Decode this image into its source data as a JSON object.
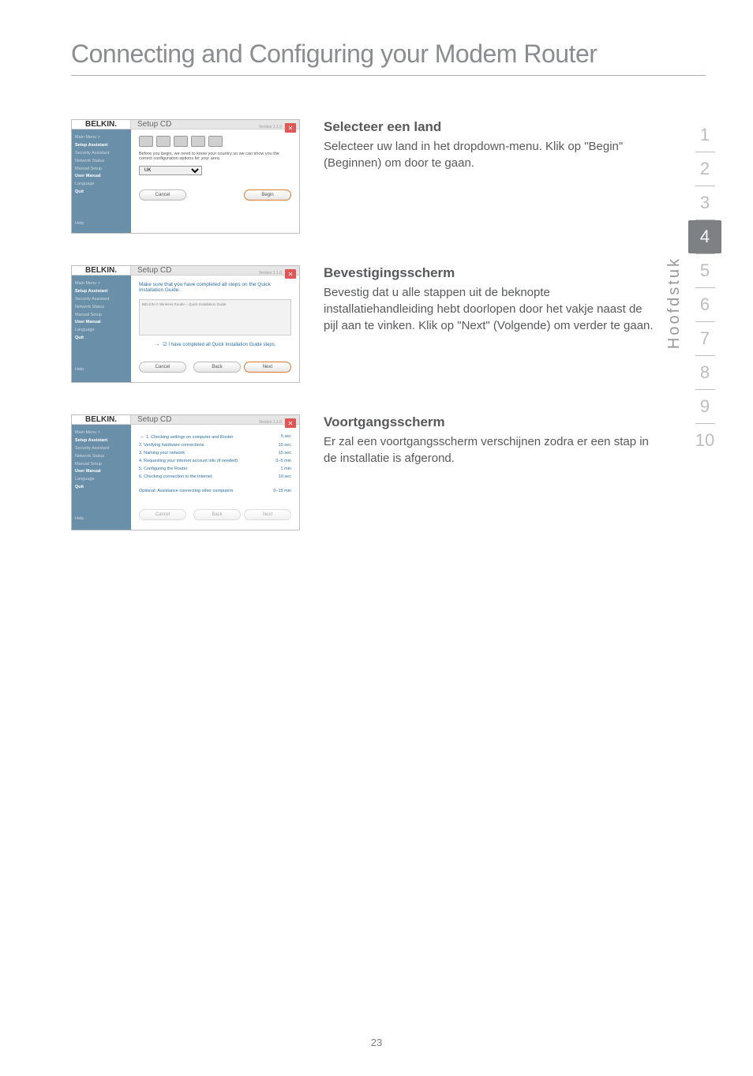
{
  "page_title": "Connecting and Configuring your Modem Router",
  "page_number": "23",
  "chapter_label": "Hoofdstuk",
  "nav": [
    "1",
    "2",
    "3",
    "4",
    "5",
    "6",
    "7",
    "8",
    "9",
    "10"
  ],
  "active_chapter": "4",
  "shot_common": {
    "logo": "BELKIN.",
    "title": "Setup CD",
    "version": "Version 1.1.0",
    "side": {
      "main_menu": "Main Menu  >",
      "setup_assistant": "Setup Assistant",
      "security_assistant": "Security Assistant",
      "network_status": "Network Status",
      "manual_setup": "Manual Setup",
      "user_manual": "User Manual",
      "language": "Language",
      "quit": "Quit",
      "help": "Help"
    }
  },
  "sections": [
    {
      "heading": "Selecteer een land",
      "body": "Selecteer uw land in het dropdown-menu. Klik op \"Begin\" (Beginnen) om door te gaan.",
      "shot": {
        "below": "Before you begin, we need to know your country so we can show you the correct configuration options for your area.",
        "select_value": "UK",
        "cancel": "Cancel",
        "begin": "Begin"
      }
    },
    {
      "heading": "Bevestigingsscherm",
      "body": "Bevestig dat u alle stappen uit de beknopte installatiehandleiding hebt doorlopen door het vakje naast de pijl aan te vinken. Klik op \"Next\" (Volgende) om verder te gaan.",
      "shot": {
        "msg": "Make sure that you have completed all steps on the Quick Installation Guide.",
        "preview_title": "BELKIN  G Wireless Router – Quick Installation Guide",
        "checkbox": "I have completed all Quick Installation Guide steps.",
        "cancel": "Cancel",
        "back": "Back",
        "next": "Next"
      }
    },
    {
      "heading": "Voortgangsscherm",
      "body": "Er zal een voortgangsscherm verschijnen zodra er een stap in de installatie is afgerond.",
      "shot": {
        "steps": [
          {
            "label": "1. Checking settings on computer and Router",
            "time": "5 sec"
          },
          {
            "label": "2. Verifying hardware connections",
            "time": "15 sec"
          },
          {
            "label": "3. Naming your network",
            "time": "15 sec"
          },
          {
            "label": "4. Requesting your internet account info (if needed)",
            "time": "0–5 min"
          },
          {
            "label": "5. Configuring the Router",
            "time": "1 min"
          },
          {
            "label": "6. Checking connection to the Internet",
            "time": "10 sec"
          }
        ],
        "optional": {
          "label": "Optional: Assistance connecting other computers",
          "time": "0–15 min"
        },
        "cancel": "Cancel",
        "back": "Back",
        "next": "Next"
      }
    }
  ]
}
